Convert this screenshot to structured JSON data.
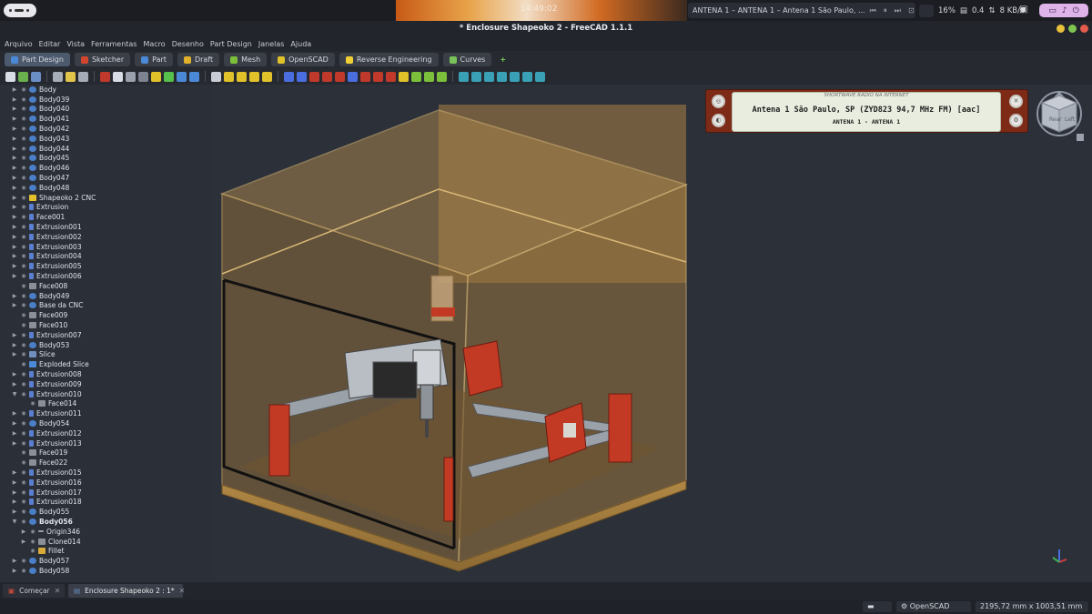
{
  "top_panel": {
    "clock": "14:49:02",
    "media": {
      "title": "ANTENA 1 – ANTENA 1 – Antena 1 São Paulo, ..."
    },
    "cpu": "16%",
    "load": "0.4",
    "net": "8 KB/s"
  },
  "window": {
    "title": "* Enclosure Shapeoko 2 - FreeCAD 1.1.1"
  },
  "menu": [
    "Arquivo",
    "Editar",
    "Vista",
    "Ferramentas",
    "Macro",
    "Desenho",
    "Part Design",
    "Janelas",
    "Ajuda"
  ],
  "workbenches": [
    {
      "label": "Part Design",
      "color": "#4a89d6",
      "active": true
    },
    {
      "label": "Sketcher",
      "color": "#d4452e",
      "active": false
    },
    {
      "label": "Part",
      "color": "#4a89d6",
      "active": false
    },
    {
      "label": "Draft",
      "color": "#e0b12a",
      "active": false
    },
    {
      "label": "Mesh",
      "color": "#7bbf3a",
      "active": false
    },
    {
      "label": "OpenSCAD",
      "color": "#e0c22a",
      "active": false
    },
    {
      "label": "Reverse Engineering",
      "color": "#f0cf36",
      "active": false
    },
    {
      "label": "Curves",
      "color": "#79c25a",
      "active": false
    }
  ],
  "tree": [
    {
      "label": "Body",
      "icon": "body",
      "arrow": "right",
      "indent": 0
    },
    {
      "label": "Body039",
      "icon": "body",
      "arrow": "right",
      "indent": 0
    },
    {
      "label": "Body040",
      "icon": "body",
      "arrow": "right",
      "indent": 0
    },
    {
      "label": "Body041",
      "icon": "body",
      "arrow": "right",
      "indent": 0
    },
    {
      "label": "Body042",
      "icon": "body",
      "arrow": "right",
      "indent": 0
    },
    {
      "label": "Body043",
      "icon": "body",
      "arrow": "right",
      "indent": 0
    },
    {
      "label": "Body044",
      "icon": "body",
      "arrow": "right",
      "indent": 0
    },
    {
      "label": "Body045",
      "icon": "body",
      "arrow": "right",
      "indent": 0
    },
    {
      "label": "Body046",
      "icon": "body",
      "arrow": "right",
      "indent": 0
    },
    {
      "label": "Body047",
      "icon": "body",
      "arrow": "right",
      "indent": 0
    },
    {
      "label": "Body048",
      "icon": "body",
      "arrow": "right",
      "indent": 0
    },
    {
      "label": "Shapeoko 2 CNC",
      "icon": "part",
      "arrow": "right",
      "indent": 0
    },
    {
      "label": "Extrusion",
      "icon": "ext",
      "arrow": "right",
      "indent": 0
    },
    {
      "label": "Face001",
      "icon": "ext",
      "arrow": "right",
      "indent": 0
    },
    {
      "label": "Extrusion001",
      "icon": "ext",
      "arrow": "right",
      "indent": 0
    },
    {
      "label": "Extrusion002",
      "icon": "ext",
      "arrow": "right",
      "indent": 0
    },
    {
      "label": "Extrusion003",
      "icon": "ext",
      "arrow": "right",
      "indent": 0
    },
    {
      "label": "Extrusion004",
      "icon": "ext",
      "arrow": "right",
      "indent": 0
    },
    {
      "label": "Extrusion005",
      "icon": "ext",
      "arrow": "right",
      "indent": 0
    },
    {
      "label": "Extrusion006",
      "icon": "ext",
      "arrow": "right",
      "indent": 0
    },
    {
      "label": "Face008",
      "icon": "face",
      "arrow": "none",
      "indent": 0
    },
    {
      "label": "Body049",
      "icon": "body",
      "arrow": "right",
      "indent": 0
    },
    {
      "label": "Base da CNC",
      "icon": "body",
      "arrow": "right",
      "indent": 0
    },
    {
      "label": "Face009",
      "icon": "face",
      "arrow": "none",
      "indent": 0
    },
    {
      "label": "Face010",
      "icon": "face",
      "arrow": "none",
      "indent": 0
    },
    {
      "label": "Extrusion007",
      "icon": "ext",
      "arrow": "right",
      "indent": 0
    },
    {
      "label": "Body053",
      "icon": "body",
      "arrow": "right",
      "indent": 0
    },
    {
      "label": "Slice",
      "icon": "slice",
      "arrow": "right",
      "indent": 0
    },
    {
      "label": "Exploded Slice",
      "icon": "exs",
      "arrow": "none",
      "indent": 0
    },
    {
      "label": "Extrusion008",
      "icon": "ext",
      "arrow": "right",
      "indent": 0
    },
    {
      "label": "Extrusion009",
      "icon": "ext",
      "arrow": "right",
      "indent": 0
    },
    {
      "label": "Extrusion010",
      "icon": "ext",
      "arrow": "down",
      "indent": 0
    },
    {
      "label": "Face014",
      "icon": "face",
      "arrow": "none",
      "indent": 1
    },
    {
      "label": "Extrusion011",
      "icon": "ext",
      "arrow": "right",
      "indent": 0
    },
    {
      "label": "Body054",
      "icon": "body",
      "arrow": "right",
      "indent": 0
    },
    {
      "label": "Extrusion012",
      "icon": "ext",
      "arrow": "right",
      "indent": 0
    },
    {
      "label": "Extrusion013",
      "icon": "ext",
      "arrow": "right",
      "indent": 0
    },
    {
      "label": "Face019",
      "icon": "face",
      "arrow": "none",
      "indent": 0
    },
    {
      "label": "Face022",
      "icon": "face",
      "arrow": "none",
      "indent": 0
    },
    {
      "label": "Extrusion015",
      "icon": "ext",
      "arrow": "right",
      "indent": 0
    },
    {
      "label": "Extrusion016",
      "icon": "ext",
      "arrow": "right",
      "indent": 0
    },
    {
      "label": "Extrusion017",
      "icon": "ext",
      "arrow": "right",
      "indent": 0
    },
    {
      "label": "Extrusion018",
      "icon": "ext",
      "arrow": "right",
      "indent": 0
    },
    {
      "label": "Body055",
      "icon": "body",
      "arrow": "right",
      "indent": 0
    },
    {
      "label": "Body056",
      "icon": "body",
      "arrow": "down",
      "indent": 0,
      "bold": true
    },
    {
      "label": "Origin346",
      "icon": "origin",
      "arrow": "right",
      "indent": 1
    },
    {
      "label": "Clone014",
      "icon": "face",
      "arrow": "right",
      "indent": 1
    },
    {
      "label": "Fillet",
      "icon": "fillet",
      "arrow": "none",
      "indent": 1
    },
    {
      "label": "Body057",
      "icon": "body",
      "arrow": "right",
      "indent": 0
    },
    {
      "label": "Body058",
      "icon": "body",
      "arrow": "right",
      "indent": 0
    }
  ],
  "radio": {
    "caption": "SHORTWAVE RADIO NA INTERNET",
    "station": "Antena 1 São Paulo, SP (ZYD823 94,7 MHz FM) [aac]",
    "subtitle": "ANTENA 1 - ANTENA 1"
  },
  "navcube": {
    "face_left": "Rear",
    "face_right": "Left"
  },
  "tabs": [
    {
      "label": "Começar",
      "active": false
    },
    {
      "label": "Enclosure Shapeoko 2 : 1*",
      "active": true
    }
  ],
  "status": {
    "nav_style": "OpenSCAD",
    "dimensions": "2195,72 mm x 1003,51 mm"
  }
}
